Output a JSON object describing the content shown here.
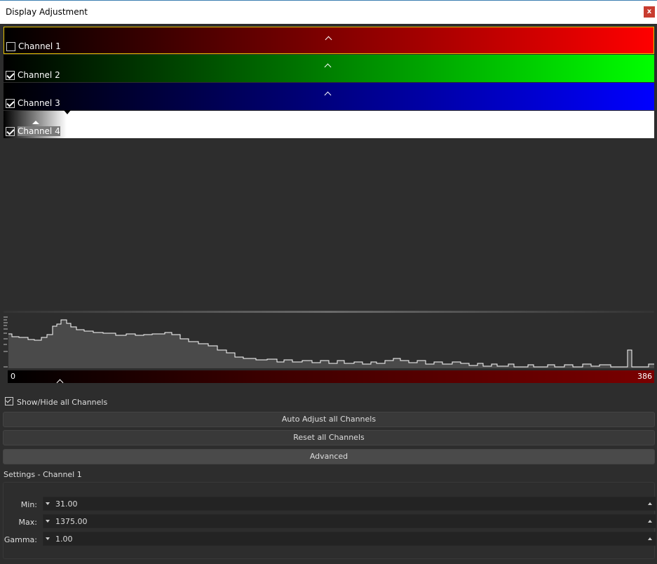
{
  "window": {
    "title": "Display Adjustment",
    "close_label": "x"
  },
  "channels": [
    {
      "label": "Channel 1",
      "checked": false,
      "color": "#ff0000"
    },
    {
      "label": "Channel 2",
      "checked": true,
      "color": "#00ff00"
    },
    {
      "label": "Channel 3",
      "checked": true,
      "color": "#0000ff"
    },
    {
      "label": "Channel 4",
      "checked": true,
      "color": "#ffffff"
    }
  ],
  "histogram": {
    "min_label": "0",
    "max_label": "386"
  },
  "controls": {
    "show_hide_label": "Show/Hide all Channels",
    "auto_adjust_label": "Auto Adjust all Channels",
    "reset_label": "Reset all Channels",
    "advanced_label": "Advanced"
  },
  "settings": {
    "title": "Settings - Channel 1",
    "min_label": "Min:",
    "min_value": "31.00",
    "max_label": "Max:",
    "max_value": "1375.00",
    "gamma_label": "Gamma:",
    "gamma_value": "1.00"
  },
  "colors": {
    "selected_border": "#e6c200",
    "background": "#2d2d2d"
  }
}
